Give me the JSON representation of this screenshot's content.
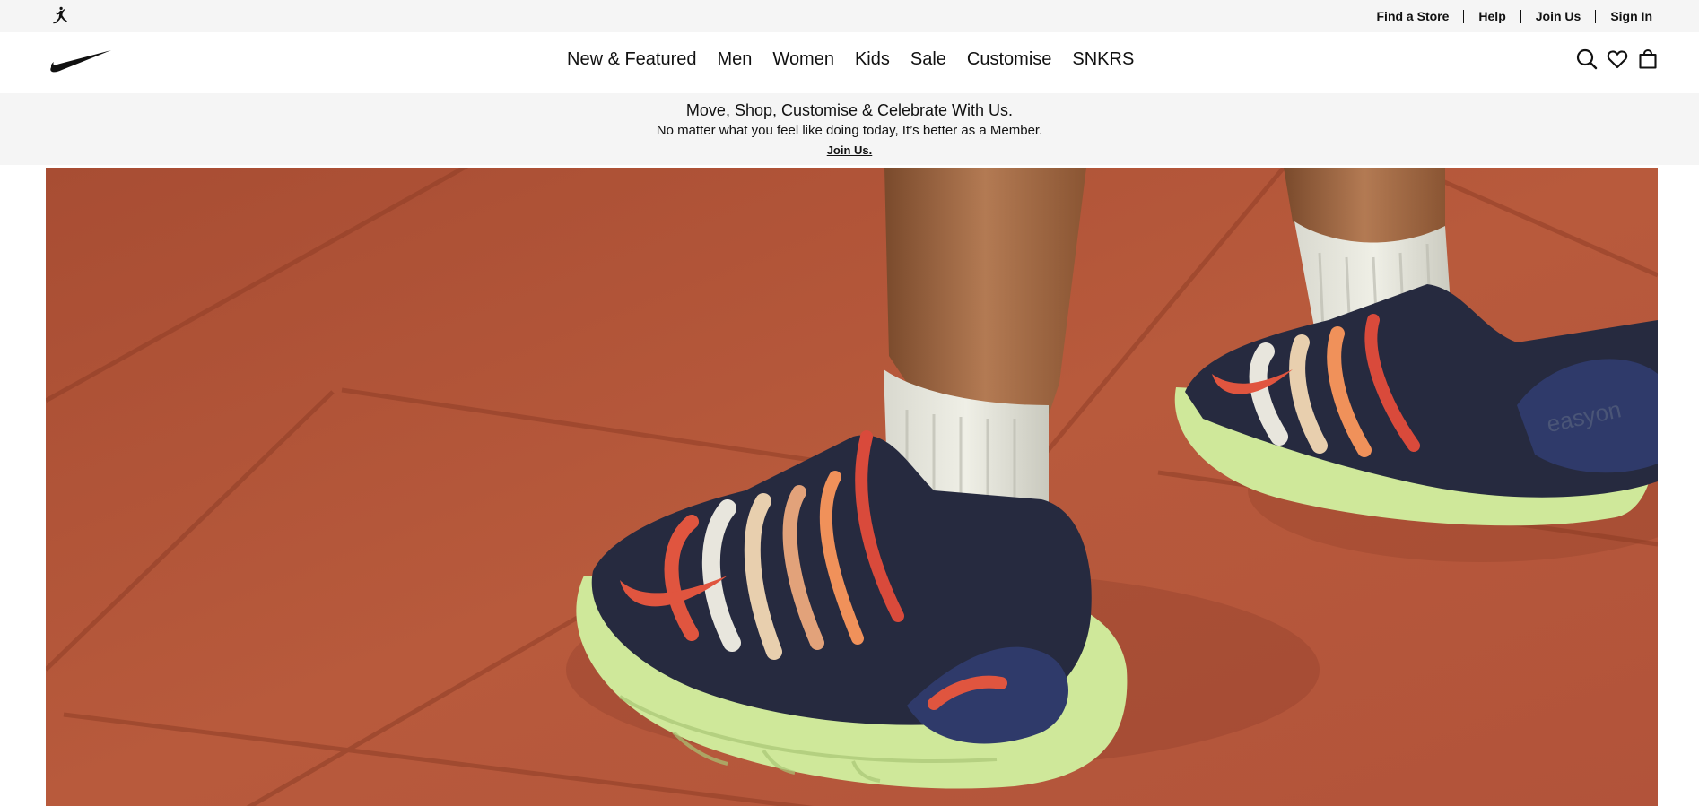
{
  "utility_bar": {
    "links": [
      "Find a Store",
      "Help",
      "Join Us",
      "Sign In"
    ]
  },
  "nav": {
    "items": [
      "New & Featured",
      "Men",
      "Women",
      "Kids",
      "Sale",
      "Customise",
      "SNKRS"
    ],
    "icons": [
      "search-icon",
      "heart-icon",
      "bag-icon"
    ]
  },
  "promo": {
    "headline": "Move, Shop, Customise & Celebrate With Us.",
    "subtext": "No matter what you feel like doing today, It’s better as a Member.",
    "link": "Join Us."
  },
  "hero": {
    "alt": "Child wearing Nike slip-on shoes with colourful wavy straps and lime soles, standing on red brick tiles",
    "shoe_text": "easyon"
  },
  "colors": {
    "top_bar_bg": "#f5f5f5",
    "text": "#111111",
    "brick": "#b5573a",
    "shoe_navy": "#262a3f",
    "sole_lime": "#cfe89a",
    "swoosh_red": "#e0553f"
  }
}
